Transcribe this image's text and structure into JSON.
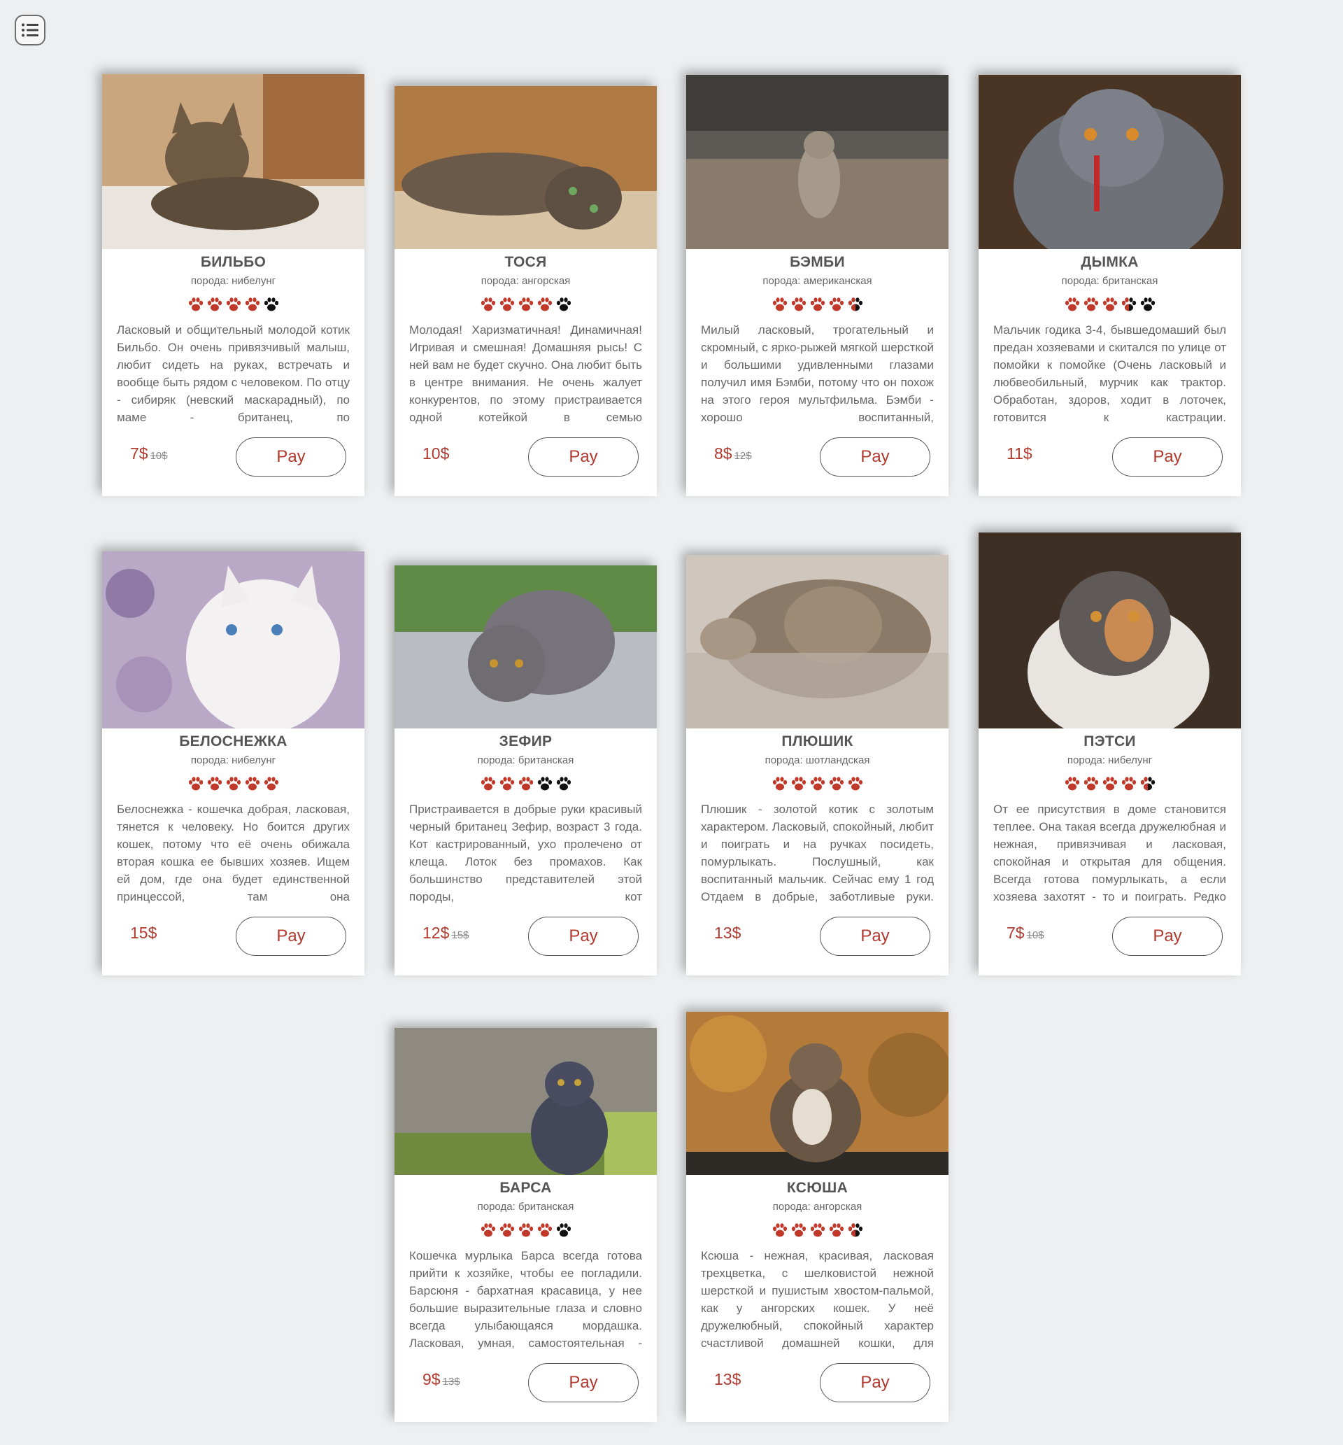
{
  "menu": {
    "icon": "list-icon"
  },
  "colors": {
    "accent": "#b1392e",
    "paw_on": "#c0392b",
    "paw_off": "#111111",
    "background": "#edeff0"
  },
  "cards": [
    {
      "name": "БИЛЬБО",
      "breed": "порода: нибелунг",
      "rating": 4,
      "description": "Ласковый и общительный молодой котик Бильбо. Он очень привязчивый малыш, любит сидеть на руках, встречать и вообще быть рядом с человеком. По отцу - сибиряк (невский маскарадный), по маме - британец, по",
      "price": "7$",
      "old_price": "10$",
      "pay_label": "Pay"
    },
    {
      "name": "ТОСЯ",
      "breed": "порода: ангорская",
      "rating": 4,
      "description": "Молодая! Харизматичная! Динамичная! Игривая и смешная! Домашняя рысь! С ней вам не будет скучно. Она любит быть в центре внимания. Не очень жалует конкурентов, по этому пристраивается одной котейкой в семью",
      "price": "10$",
      "old_price": "",
      "pay_label": "Pay"
    },
    {
      "name": "БЭМБИ",
      "breed": "порода: американская",
      "rating": 4.5,
      "description": "Милый ласковый, трогательный и скромный, с ярко-рыжей мягкой шерсткой и большими удивленными глазами получил имя Бэмби, потому что он похож на этого героя мультфильма. Бэмби - хорошо воспитанный,",
      "price": "8$",
      "old_price": "12$",
      "pay_label": "Pay"
    },
    {
      "name": "ДЫМКА",
      "breed": "порода: британская",
      "rating": 3.5,
      "description": "Мальчик годика 3-4, бывшедомаший был предан хозяевами и скитался по улице от помойки к помойке (Очень ласковый и любвеобильный, мурчик как трактор. Обработан, здоров, ходит в лоточек, готовится к кастрации.",
      "price": "11$",
      "old_price": "",
      "pay_label": "Pay"
    },
    {
      "name": "БЕЛОСНЕЖКА",
      "breed": "порода: нибелунг",
      "rating": 5,
      "description": "Белоснежка - кошечка добрая, ласковая, тянется к человеку. Но боится других кошек, потому что её очень обижала вторая кошка ее бывших хозяев. Ищем ей дом, где она будет единственной принцессой, там она",
      "price": "15$",
      "old_price": "",
      "pay_label": "Pay"
    },
    {
      "name": "ЗЕФИР",
      "breed": "порода: британская",
      "rating": 3,
      "description": "Пристраивается в добрые руки красивый черный британец Зефир, возраст 3 года. Кот кастрированный, ухо пролечено от клеща. Лоток без промахов. Как большинство представителей этой породы, кот",
      "price": "12$",
      "old_price": "15$",
      "pay_label": "Pay"
    },
    {
      "name": "ПЛЮШИК",
      "breed": "порода: шотландская",
      "rating": 5,
      "description": "Плюшик - золотой котик с золотым характером. Ласковый, спокойный, любит и поиграть и на ручках посидеть, помурлыкать. Послушный, как воспитанный мальчик. Сейчас ему 1 год Отдаем в добрые, заботливые руки.",
      "price": "13$",
      "old_price": "",
      "pay_label": "Pay"
    },
    {
      "name": "ПЭТСИ",
      "breed": "порода: нибелунг",
      "rating": 4.5,
      "description": "От ее присутствия в доме становится теплее. Она такая всегда дружелюбная и нежная, привязчивая и ласковая, спокойная и открытая для общения. Всегда готова помурлыкать, а если хозяева захотят - то и поиграть. Редко",
      "price": "7$",
      "old_price": "10$",
      "pay_label": "Pay"
    },
    {
      "name": "БАРСА",
      "breed": "порода: британская",
      "rating": 4,
      "description": "Кошечка мурлыка Барса всегда готова прийти к хозяйке, чтобы ее погладили. Барсюня - бархатная красавица, у нее большие выразительные глаза и словно всегда улыбающаяся мордашка. Ласковая, умная, самостоятельная -",
      "price": "9$",
      "old_price": "13$",
      "pay_label": "Pay"
    },
    {
      "name": "КСЮША",
      "breed": "порода: ангорская",
      "rating": 4.5,
      "description": "Ксюша - нежная, красивая, ласковая трехцветка, с шелковистой нежной шерсткой и пушистым хвостом-пальмой, как у ангорских кошек. У неё дружелюбный, спокойный характер счастливой домашней кошки, для",
      "price": "13$",
      "old_price": "",
      "pay_label": "Pay"
    }
  ]
}
